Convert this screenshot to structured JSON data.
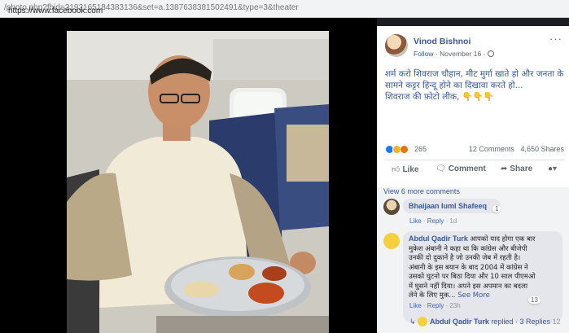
{
  "browser": {
    "url_prefix": "https://www.facebook.com",
    "url_rest": "/photo.php?fbid=2192165184383136&set=a.1387638381502491&type=3&theater"
  },
  "post": {
    "author": "Vinod Bishnoi",
    "follow_label": "Follow",
    "date": "November 16",
    "more_icon": "more-dots-icon",
    "text_lines": [
      "शर्म करो शिवराज चौहान, मीट मुर्गा खाते हो और जनता के",
      "सामने कट्टर हिन्दू होने का दिखावा करते हो...",
      "शिवराज की फ़ोटो लीक,"
    ],
    "text_emoji": "👇👇👇",
    "reaction_count": "265",
    "comments_count": "12 Comments",
    "shares_count": "4,650 Shares"
  },
  "actions": {
    "like": "Like",
    "comment": "Comment",
    "share": "Share"
  },
  "comments": {
    "view_more": "View 6 more comments",
    "items": [
      {
        "name": "Bhaijaan Iuml Shafeeq",
        "text_lines": [],
        "like_label": "Like",
        "reply_label": "Reply",
        "time": "1d",
        "reaction_count": "1"
      },
      {
        "name": "Abdul Qadir Turk",
        "text_lines": [
          "आपको याद होगा एक बार",
          "मुकेश अंबानी ने कहा था कि कांग्रेस और बीजेपी",
          "उनकी दो दुकानें है जो उनकी जेब में रहती है।",
          "अंबानी के इस बयान के बाद 2004 में कांग्रेस ने",
          "उसको घुटनो पर बिठा दिया और 10 साल पीएमओ",
          "में घुसने नहीं दिया। अपने इस अपमान का बदला",
          "लेने के लिए मुक..."
        ],
        "see_more": "See More",
        "like_label": "Like",
        "reply_label": "Reply",
        "time": "23h",
        "reaction_count": "13"
      }
    ],
    "reply_summary": {
      "name": "Abdul Qadir Turk",
      "replied": "replied",
      "sep": "·",
      "count": "3 Replies",
      "trailing": "12"
    }
  },
  "colors": {
    "fb_blue": "#385898",
    "text_gray": "#616770",
    "like_blue": "#1877f2",
    "panel_bg": "#ffffff",
    "theater_bg": "#000000"
  }
}
